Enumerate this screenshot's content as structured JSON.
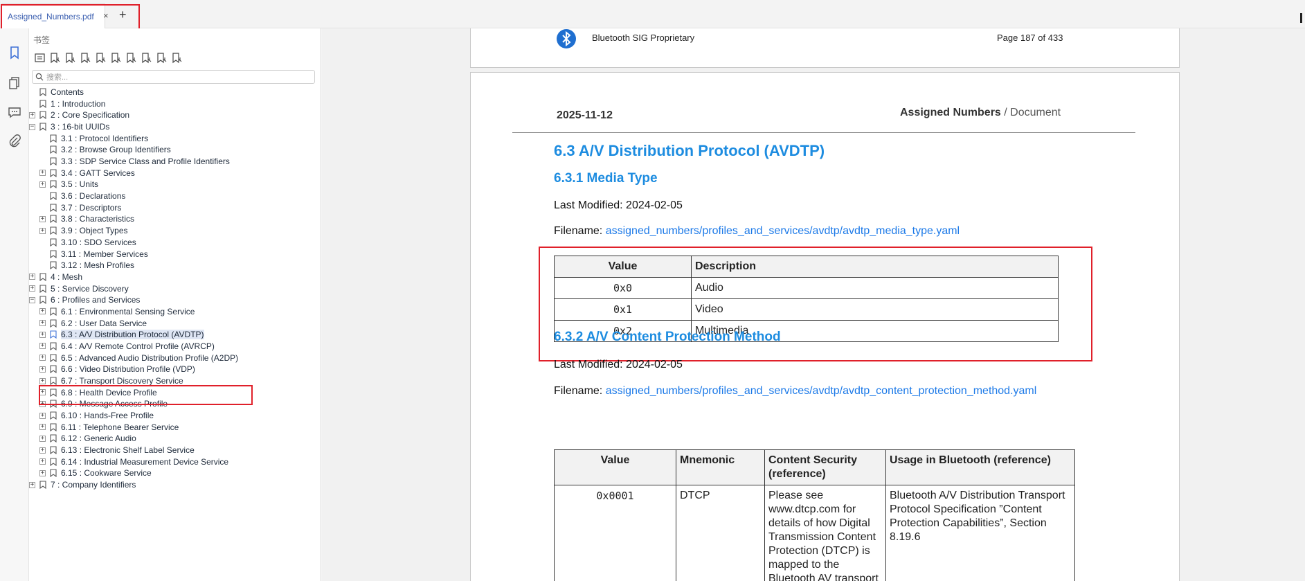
{
  "tab": {
    "title": "Assigned_Numbers.pdf",
    "close": "×",
    "add": "+"
  },
  "rail": {
    "icons": [
      "bookmark-icon",
      "pages-icon",
      "comment-icon",
      "attachment-icon"
    ]
  },
  "panel": {
    "title": "书签",
    "search_placeholder": "搜索...",
    "tools": [
      "bookmark-list-icon",
      "add-bookmark-icon",
      "delete-bookmark-icon",
      "bookmark-properties-icon",
      "font-increase-icon",
      "font-decrease-icon",
      "expand-bookmark-icon",
      "collapse-bookmark-icon",
      "bookmark-page-icon",
      "find-bookmark-icon"
    ]
  },
  "tree": [
    {
      "label": "Contents",
      "expander": "",
      "level": 0
    },
    {
      "label": "1 : Introduction",
      "expander": "",
      "level": 0
    },
    {
      "label": "2 : Core Specification",
      "expander": "+",
      "level": 0
    },
    {
      "label": "3 : 16-bit UUIDs",
      "expander": "-",
      "level": 0
    },
    {
      "label": "3.1 : Protocol Identifiers",
      "expander": "",
      "level": 1
    },
    {
      "label": "3.2 : Browse Group Identifiers",
      "expander": "",
      "level": 1
    },
    {
      "label": "3.3 : SDP Service Class and Profile Identifiers",
      "expander": "",
      "level": 1
    },
    {
      "label": "3.4 : GATT Services",
      "expander": "+",
      "level": 1
    },
    {
      "label": "3.5 : Units",
      "expander": "+",
      "level": 1
    },
    {
      "label": "3.6 : Declarations",
      "expander": "",
      "level": 1
    },
    {
      "label": "3.7 : Descriptors",
      "expander": "",
      "level": 1
    },
    {
      "label": "3.8 : Characteristics",
      "expander": "+",
      "level": 1
    },
    {
      "label": "3.9 : Object Types",
      "expander": "+",
      "level": 1
    },
    {
      "label": "3.10 : SDO Services",
      "expander": "",
      "level": 1
    },
    {
      "label": "3.11 : Member Services",
      "expander": "",
      "level": 1
    },
    {
      "label": "3.12 : Mesh Profiles",
      "expander": "",
      "level": 1
    },
    {
      "label": "4 : Mesh",
      "expander": "+",
      "level": 0
    },
    {
      "label": "5 : Service Discovery",
      "expander": "+",
      "level": 0
    },
    {
      "label": "6 : Profiles and Services",
      "expander": "-",
      "level": 0
    },
    {
      "label": "6.1 : Environmental Sensing Service",
      "expander": "+",
      "level": 1
    },
    {
      "label": "6.2 : User Data Service",
      "expander": "+",
      "level": 1
    },
    {
      "label": "6.3 : A/V Distribution Protocol (AVDTP)",
      "expander": "+",
      "level": 1,
      "selected": true
    },
    {
      "label": "6.4 : A/V Remote Control Profile (AVRCP)",
      "expander": "+",
      "level": 1
    },
    {
      "label": "6.5 : Advanced Audio Distribution Profile (A2DP)",
      "expander": "+",
      "level": 1
    },
    {
      "label": "6.6 : Video Distribution Profile (VDP)",
      "expander": "+",
      "level": 1
    },
    {
      "label": "6.7 : Transport Discovery Service",
      "expander": "+",
      "level": 1
    },
    {
      "label": "6.8 : Health Device Profile",
      "expander": "+",
      "level": 1
    },
    {
      "label": "6.9 : Message Access Profile",
      "expander": "+",
      "level": 1
    },
    {
      "label": "6.10 : Hands-Free Profile",
      "expander": "+",
      "level": 1
    },
    {
      "label": "6.11 : Telephone Bearer Service",
      "expander": "+",
      "level": 1
    },
    {
      "label": "6.12 : Generic Audio",
      "expander": "+",
      "level": 1
    },
    {
      "label": "6.13 : Electronic Shelf Label Service",
      "expander": "+",
      "level": 1
    },
    {
      "label": "6.14 : Industrial Measurement Device Service",
      "expander": "+",
      "level": 1
    },
    {
      "label": "6.15 : Cookware Service",
      "expander": "+",
      "level": 1
    },
    {
      "label": "7 : Company Identifiers",
      "expander": "+",
      "level": 0
    }
  ],
  "doc": {
    "prev_footer_left": "Bluetooth SIG Proprietary",
    "prev_footer_right": "Page 187 of 433",
    "date": "2025-11-12",
    "header_bold": "Assigned Numbers",
    "header_rest": " / Document",
    "h2": "6.3   A/V Distribution Protocol (AVDTP)",
    "h3_1": "6.3.1   Media Type",
    "lm1": "Last Modified: 2024-02-05",
    "fn_label": "Filename: ",
    "fn1": "assigned_numbers/profiles_and_services/avdtp/avdtp_media_type.yaml",
    "t1_headers": [
      "Value",
      "Description"
    ],
    "t1_rows": [
      [
        "0x0",
        "Audio"
      ],
      [
        "0x1",
        "Video"
      ],
      [
        "0x2",
        "Multimedia"
      ]
    ],
    "h3_2": "6.3.2   A/V Content Protection Method",
    "lm2": "Last Modified: 2024-02-05",
    "fn2": "assigned_numbers/profiles_and_services/avdtp/avdtp_content_protection_method.yaml",
    "t2_headers": [
      "Value",
      "Mnemonic",
      "Content Security (reference)",
      "Usage in Bluetooth (reference)"
    ],
    "t2_rows": [
      [
        "0x0001",
        "DTCP",
        "Please see www.dtcp.com for details of how Digital Transmission Content Protection (DTCP) is mapped to the Bluetooth AV transport",
        "Bluetooth A/V Distribution Transport Protocol Specification ”Content Protection Capabilities”, Section 8.19.6"
      ]
    ]
  }
}
